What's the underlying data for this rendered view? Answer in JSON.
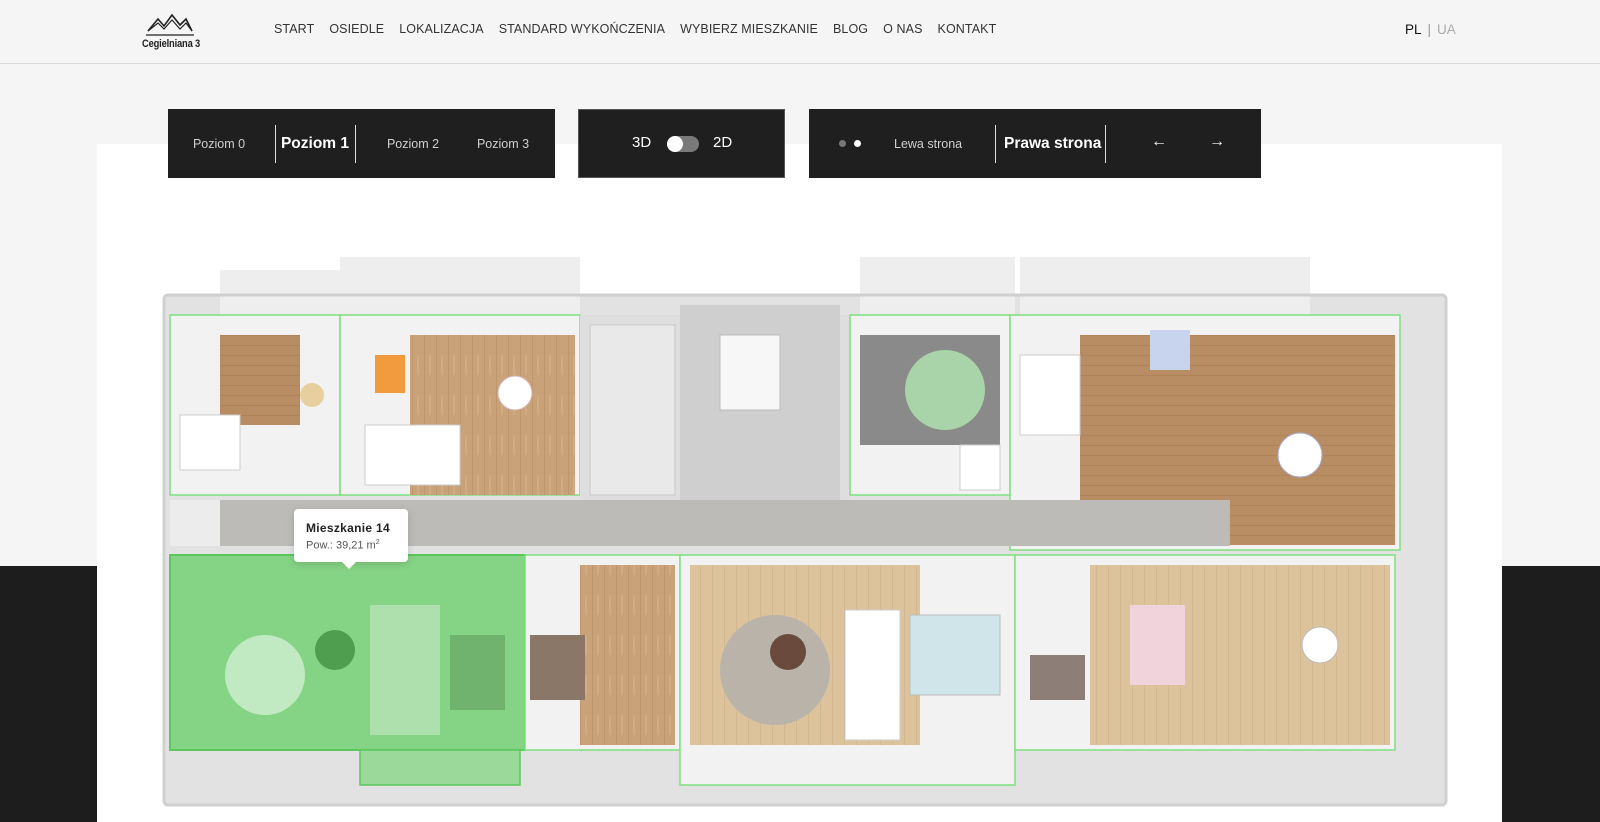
{
  "header": {
    "logo_text": "Cegielniana 3",
    "nav": [
      "START",
      "OSIEDLE",
      "LOKALIZACJA",
      "STANDARD WYKOŃCZENIA",
      "WYBIERZ MIESZKANIE",
      "BLOG",
      "O NAS",
      "KONTAKT"
    ],
    "lang": {
      "active": "PL",
      "separator": "|",
      "other": "UA"
    }
  },
  "levels": {
    "items": [
      "Poziom 0",
      "Poziom 1",
      "Poziom 2",
      "Poziom 3"
    ],
    "active": "Poziom 1"
  },
  "view_toggle": {
    "left": "3D",
    "right": "2D",
    "selected": "3D"
  },
  "sides": {
    "left": "Lewa strona",
    "right": "Prawa strona",
    "active": "Prawa strona",
    "prev_icon": "←",
    "next_icon": "→"
  },
  "tooltip": {
    "title": "Mieszkanie 14",
    "area_label": "Pow.: 39,21 m",
    "area_unit_sup": "2"
  },
  "colors": {
    "header_bg": "#f5f5f5",
    "panel_bg": "#1f1f1f",
    "highlight_green": "#5bc85b",
    "outline_green": "#7ee07e",
    "dark_band": "#1d1d1d"
  }
}
